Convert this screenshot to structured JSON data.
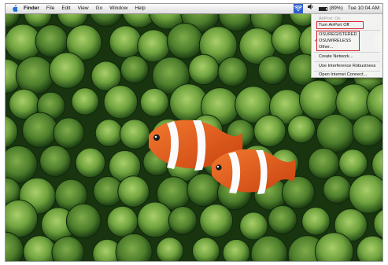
{
  "menubar": {
    "apple_icon": "apple-icon",
    "app_name": "Finder",
    "menus": [
      "File",
      "Edit",
      "View",
      "Go",
      "Window",
      "Help"
    ],
    "status": {
      "airport_icon": "wifi-icon",
      "volume_icon": "speaker-icon",
      "battery_icon": "battery-icon",
      "battery_percent": "(89%)",
      "battery_level": 0.89,
      "clock": "Tue 10:04 AM"
    }
  },
  "airport_menu": {
    "status_text": "AirPort: On",
    "turn_off_label": "Turn AirPort Off",
    "networks": [
      {
        "name": "OSUREGISTERED",
        "checked": false
      },
      {
        "name": "OSUWIRELESS",
        "checked": true
      },
      {
        "name": "Other...",
        "checked": false
      }
    ],
    "create_network_label": "Create Network...",
    "interference_label": "Use Interference Robustness",
    "internet_connect_label": "Open Internet Connect..."
  },
  "colors": {
    "highlight_box": "#d9232e",
    "anemone_green": "#6fa23e",
    "clownfish_orange": "#e4561c"
  }
}
